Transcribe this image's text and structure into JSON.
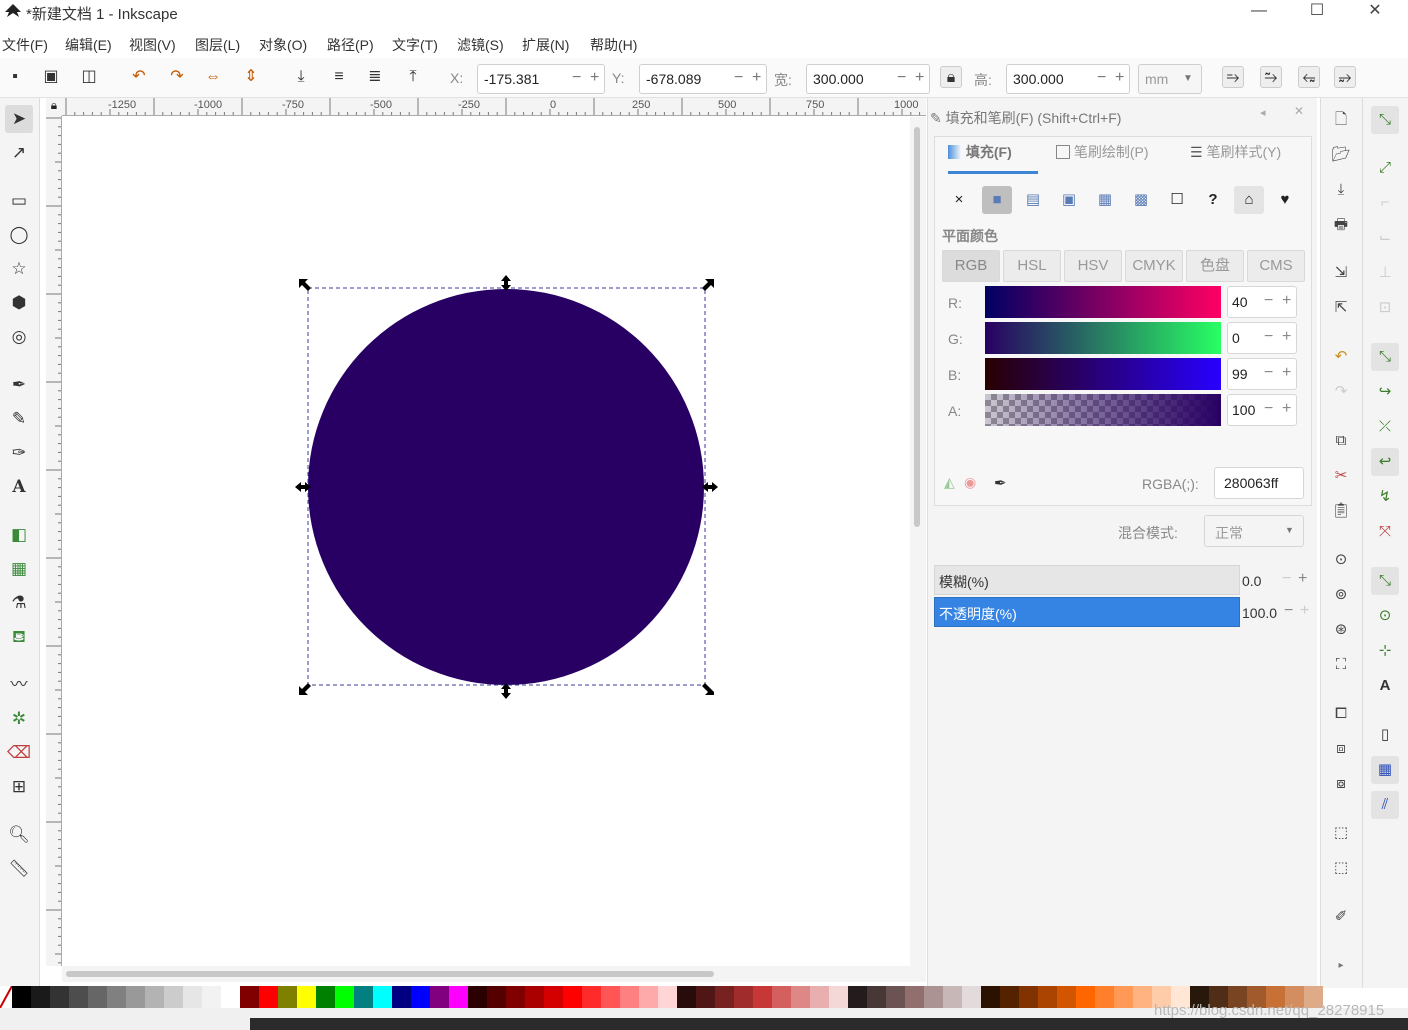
{
  "window": {
    "title": "*新建文档 1 - Inkscape",
    "minimize": "—",
    "maximize": "☐",
    "close": "✕"
  },
  "menu": [
    "文件(F)",
    "编辑(E)",
    "视图(V)",
    "图层(L)",
    "对象(O)",
    "路径(P)",
    "文字(T)",
    "滤镜(S)",
    "扩展(N)",
    "帮助(H)"
  ],
  "toolbar": {
    "x_label": "X:",
    "x_value": "-175.381",
    "y_label": "Y:",
    "y_value": "-678.089",
    "w_label": "宽:",
    "w_value": "300.000",
    "h_label": "高:",
    "h_value": "300.000",
    "unit": "mm"
  },
  "ruler": {
    "top": [
      "-1250",
      "-1000",
      "-750",
      "-500",
      "-250",
      "0",
      "250",
      "500",
      "750",
      "1000"
    ]
  },
  "canvas": {
    "circle_color": "#280063",
    "selection_color": "#3b3b9b"
  },
  "panel": {
    "title": "填充和笔刷(F) (Shift+Ctrl+F)",
    "tabs": [
      {
        "label": "填充(F)"
      },
      {
        "label": "笔刷绘制(P)"
      },
      {
        "label": "笔刷样式(Y)"
      }
    ],
    "paint_types": [
      "×",
      "■",
      "▤",
      "▣",
      "▦",
      "▩",
      "☐",
      "?",
      "⌂",
      "♥"
    ],
    "flat_color_heading": "平面颜色",
    "color_modes": [
      "RGB",
      "HSL",
      "HSV",
      "CMYK",
      "色盘",
      "CMS"
    ],
    "channels": [
      {
        "label": "R:",
        "value": "40"
      },
      {
        "label": "G:",
        "value": "0"
      },
      {
        "label": "B:",
        "value": "99"
      },
      {
        "label": "A:",
        "value": "100"
      }
    ],
    "rgba_label": "RGBA(;):",
    "rgba_value": "280063ff",
    "blend_label": "混合模式:",
    "blend_value": "正常",
    "blur_label": "模糊(%)",
    "blur_value": "0.0",
    "opacity_label": "不透明度(%)",
    "opacity_value": "100.0"
  },
  "palette": [
    "#000000",
    "#1a1a1a",
    "#333333",
    "#4d4d4d",
    "#666666",
    "#808080",
    "#999999",
    "#b3b3b3",
    "#cccccc",
    "#e6e6e6",
    "#f2f2f2",
    "#ffffff",
    "#800000",
    "#ff0000",
    "#808000",
    "#ffff00",
    "#008000",
    "#00ff00",
    "#008080",
    "#00ffff",
    "#000080",
    "#0000ff",
    "#800080",
    "#ff00ff",
    "#2b0000",
    "#550000",
    "#800000",
    "#aa0000",
    "#d40000",
    "#ff0000",
    "#ff2a2a",
    "#ff5555",
    "#ff8080",
    "#ffaaaa",
    "#ffd5d5",
    "#280b0b",
    "#501616",
    "#782121",
    "#a02c2c",
    "#c83737",
    "#d35f5f",
    "#de8787",
    "#e9afaf",
    "#f4d7d7",
    "#241c1c",
    "#483737",
    "#6c5353",
    "#916f6f",
    "#ac9393",
    "#c8b7b7",
    "#e3dbdb",
    "#2b1100",
    "#552200",
    "#803300",
    "#aa4400",
    "#d45500",
    "#ff6600",
    "#ff7f2a",
    "#ff9955",
    "#ffb380",
    "#ffccaa",
    "#ffe6d5",
    "#28170b",
    "#502d16",
    "#784421",
    "#a05a2c",
    "#c87137",
    "#d38d5f",
    "#deaa87"
  ],
  "status": {
    "watermark": "https://blog.csdn.net/qq_28278915"
  }
}
